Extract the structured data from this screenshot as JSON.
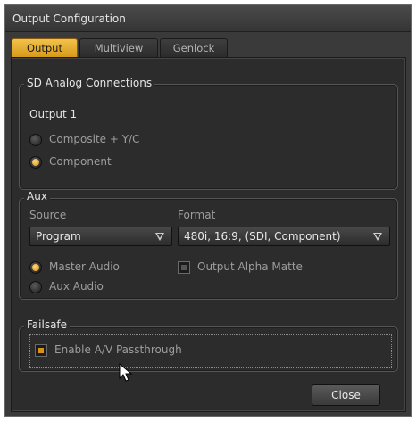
{
  "window": {
    "title": "Output Configuration"
  },
  "tabs": [
    {
      "label": "Output",
      "active": true
    },
    {
      "label": "Multiview",
      "active": false
    },
    {
      "label": "Genlock",
      "active": false
    }
  ],
  "sd_analog": {
    "legend": "SD Analog Connections",
    "output_label": "Output 1",
    "options": [
      {
        "label": "Composite + Y/C",
        "selected": false
      },
      {
        "label": "Component",
        "selected": true
      }
    ]
  },
  "aux": {
    "legend": "Aux",
    "source_label": "Source",
    "source_value": "Program",
    "format_label": "Format",
    "format_value": "480i, 16:9, (SDI, Component)",
    "audio_options": [
      {
        "label": "Master Audio",
        "selected": true
      },
      {
        "label": "Aux Audio",
        "selected": false
      }
    ],
    "alpha_matte": {
      "label": "Output Alpha Matte",
      "checked": false
    }
  },
  "failsafe": {
    "legend": "Failsafe",
    "passthrough": {
      "label": "Enable A/V Passthrough",
      "checked": true
    }
  },
  "buttons": {
    "close": "Close"
  },
  "colors": {
    "accent": "#d8921a",
    "panel": "#2c2c2c",
    "window": "#3a3a3a"
  }
}
